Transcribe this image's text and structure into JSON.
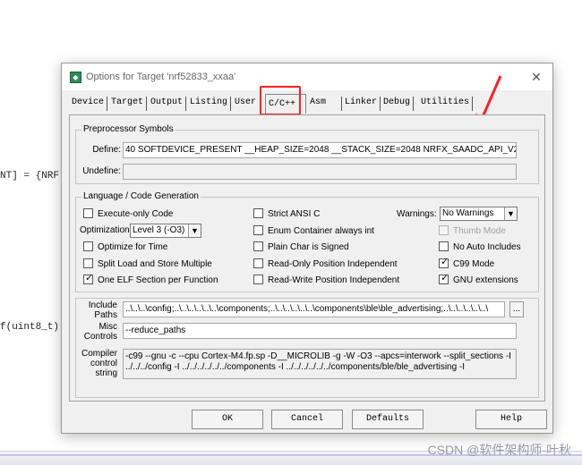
{
  "background": {
    "code_line_1": "NT] = {NRF",
    "code_line_2": "f(uint8_t)",
    "watermark": "CSDN @软件架构师-叶秋"
  },
  "dialog": {
    "title": "Options for Target 'nrf52833_xxaa'",
    "close_glyph": "✕",
    "tabs": [
      {
        "label": "Device",
        "active": false
      },
      {
        "label": "Target",
        "active": false
      },
      {
        "label": "Output",
        "active": false
      },
      {
        "label": "Listing",
        "active": false
      },
      {
        "label": "User",
        "active": false
      },
      {
        "label": "C/C++",
        "active": true
      },
      {
        "label": "Asm",
        "active": false
      },
      {
        "label": "Linker",
        "active": false
      },
      {
        "label": "Debug",
        "active": false
      },
      {
        "label": "Utilities",
        "active": false
      }
    ],
    "preprocessor": {
      "title": "Preprocessor Symbols",
      "define_label": "Define:",
      "define_value": "40 SOFTDEVICE_PRESENT __HEAP_SIZE=2048 __STACK_SIZE=2048    NRFX_SAADC_API_V2",
      "undefine_label": "Undefine:",
      "undefine_value": ""
    },
    "language": {
      "title": "Language / Code Generation",
      "execute_only": "Execute-only Code",
      "optimization_label": "Optimization:",
      "optimization_value": "Level 3 (-O3)",
      "optimize_time": "Optimize for Time",
      "split_load": "Split Load and Store Multiple",
      "one_elf": "One ELF Section per Function",
      "strict_ansi": "Strict ANSI C",
      "enum_container": "Enum Container always int",
      "plain_char": "Plain Char is Signed",
      "ro_pi": "Read-Only Position Independent",
      "rw_pi": "Read-Write Position Independent",
      "warnings_label": "Warnings:",
      "warnings_value": "No Warnings",
      "thumb_mode": "Thumb Mode",
      "no_auto_includes": "No Auto Includes",
      "c99_mode": "C99 Mode",
      "gnu_extensions": "GNU extensions"
    },
    "include_label": "Include\nPaths",
    "include_value": "..\\..\\..\\config;..\\..\\..\\..\\..\\..\\components;..\\..\\..\\..\\..\\..\\components\\ble\\ble_advertising;..\\..\\..\\..\\..\\..\\",
    "browse_label": "...",
    "misc_label": "Misc\nControls",
    "misc_value": "--reduce_paths",
    "compiler_label": "Compiler\ncontrol\nstring",
    "compiler_value": "-c99 --gnu -c --cpu Cortex-M4.fp.sp -D__MICROLIB -g -W -O3 --apcs=interwork --split_sections -I\n../../../config -I ../../../../../../components -I ../../../../../../components/ble/ble_advertising -I",
    "buttons": {
      "ok": "OK",
      "cancel": "Cancel",
      "defaults": "Defaults",
      "help": "Help"
    }
  },
  "annotations": {
    "highlight_color": "#ff2020"
  }
}
